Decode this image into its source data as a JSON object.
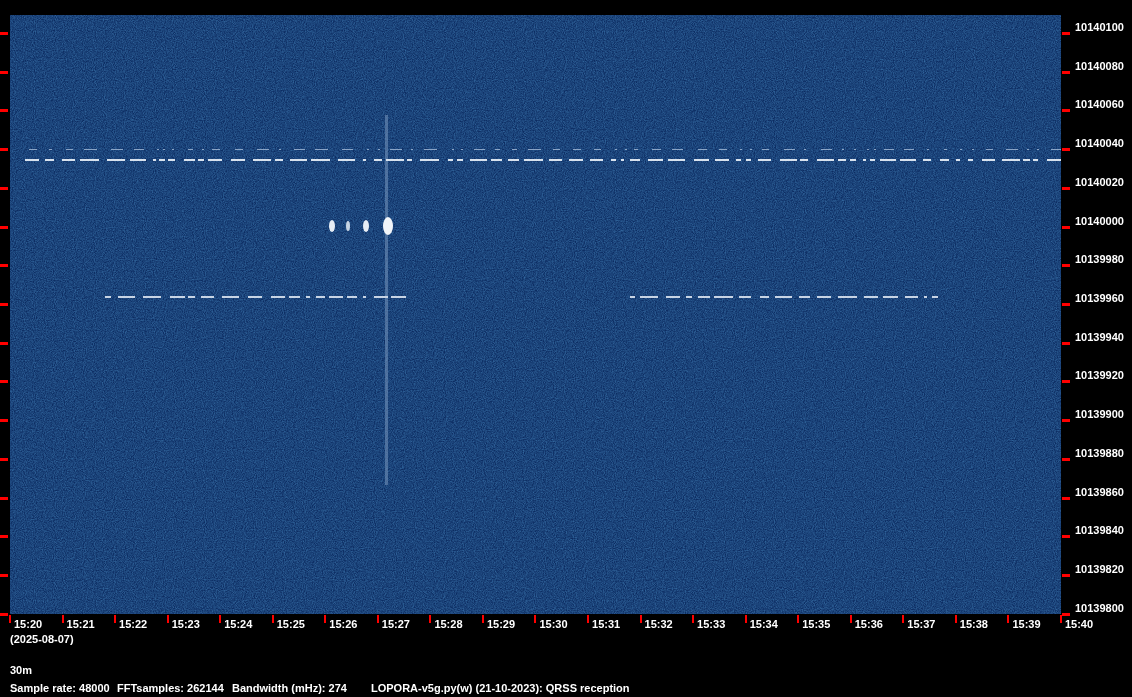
{
  "frequency_axis": {
    "labels": [
      "10140100",
      "10140080",
      "10140060",
      "10140040",
      "10140020",
      "10140000",
      "10139980",
      "10139960",
      "10139940",
      "10139920",
      "10139900",
      "10139880",
      "10139860",
      "10139840",
      "10139820",
      "10139800"
    ]
  },
  "time_axis": {
    "labels": [
      "15:20",
      "15:21",
      "15:22",
      "15:23",
      "15:24",
      "15:25",
      "15:26",
      "15:27",
      "15:28",
      "15:29",
      "15:30",
      "15:31",
      "15:32",
      "15:33",
      "15:34",
      "15:35",
      "15:36",
      "15:37",
      "15:38",
      "15:39",
      "15:40"
    ],
    "date": "(2025-08-07)"
  },
  "band": "30m",
  "footer": [
    "Sample rate: 48000",
    "FFTsamples: 262144",
    "Bandwidth (mHz): 274",
    "LOPORA-v5g.py(w) (21-10-2023): QRSS reception"
  ]
}
